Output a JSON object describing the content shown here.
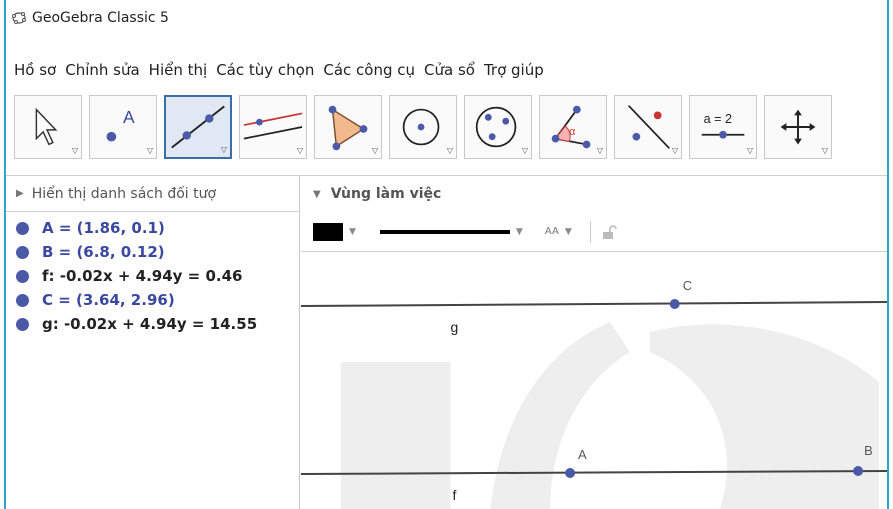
{
  "window": {
    "title": "GeoGebra Classic 5",
    "accent": "#2aa6c8"
  },
  "menu": [
    "Hồ sơ",
    "Chỉnh sửa",
    "Hiển thị",
    "Các tùy chọn",
    "Các công cụ",
    "Cửa sổ",
    "Trợ giúp"
  ],
  "toolbar": {
    "tools": [
      {
        "name": "move-tool",
        "icon": "arrow-cursor-icon"
      },
      {
        "name": "point-tool",
        "icon": "point-icon",
        "label": "A"
      },
      {
        "name": "line-tool",
        "icon": "line-through-two-points-icon",
        "active": true
      },
      {
        "name": "parallel-line-tool",
        "icon": "parallel-lines-icon"
      },
      {
        "name": "polygon-tool",
        "icon": "polygon-icon"
      },
      {
        "name": "circle-tool",
        "icon": "circle-center-icon"
      },
      {
        "name": "conic-tool",
        "icon": "ellipse-points-icon"
      },
      {
        "name": "angle-tool",
        "icon": "angle-icon",
        "label": "α"
      },
      {
        "name": "reflect-tool",
        "icon": "reflect-point-icon"
      },
      {
        "name": "slider-tool",
        "icon": "slider-icon",
        "label": "a = 2"
      },
      {
        "name": "move-graphics-tool",
        "icon": "move-arrows-icon"
      }
    ]
  },
  "algebra": {
    "header": "Hiển thị danh sách đối tượ",
    "objects": [
      {
        "text": "A = (1.86, 0.1)",
        "style": "blue"
      },
      {
        "text": "B = (6.8, 0.12)",
        "style": "blue"
      },
      {
        "text": "f: -0.02x + 4.94y = 0.46",
        "style": "black"
      },
      {
        "text": "C = (3.64, 2.96)",
        "style": "blue"
      },
      {
        "text": "g: -0.02x + 4.94y = 14.55",
        "style": "black"
      }
    ],
    "point_color": "#4a5aa8"
  },
  "graphics": {
    "header": "Vùng làm việc",
    "style_bar": {
      "aa_label": "AA"
    },
    "labels": {
      "C": "C",
      "g": "g",
      "A": "A",
      "B": "B",
      "f": "f"
    }
  }
}
